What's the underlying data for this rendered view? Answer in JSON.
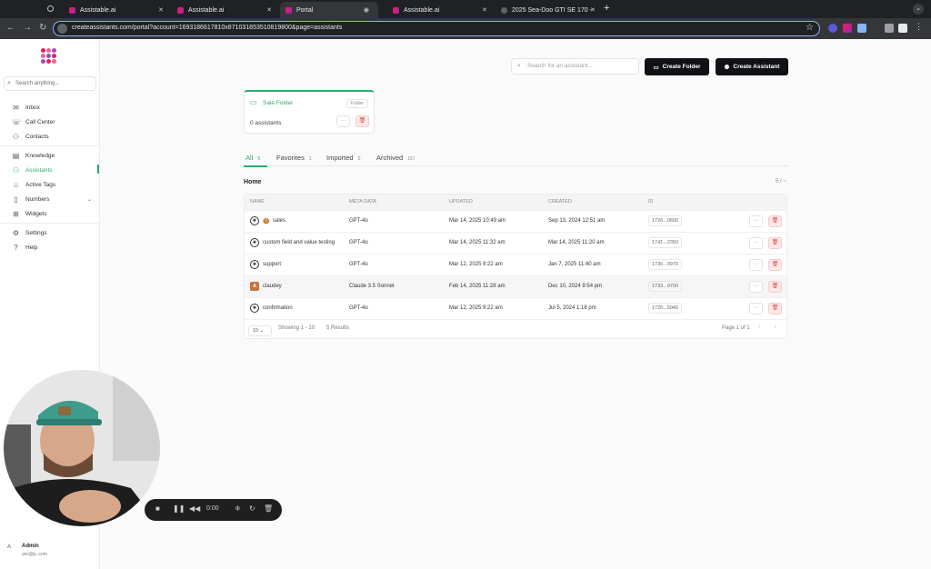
{
  "browser": {
    "tabs": [
      {
        "title": "Assistable.ai"
      },
      {
        "title": "Assistable.ai"
      },
      {
        "title": "Portal"
      },
      {
        "title": "Assistable.ai"
      },
      {
        "title": "2025 Sea-Doo GTI SE 170 - ..."
      }
    ],
    "url": "createassistants.com/portal?account=1693186617810x871031853510819800&page=assistants"
  },
  "sidebar": {
    "search_placeholder": "Search anything...",
    "items": [
      {
        "label": "Inbox",
        "icon": "inbox-icon"
      },
      {
        "label": "Call Center",
        "icon": "phone-icon"
      },
      {
        "label": "Contacts",
        "icon": "contacts-icon"
      },
      {
        "label": "Knowledge",
        "icon": "book-icon"
      },
      {
        "label": "Assistants",
        "icon": "assistant-icon"
      },
      {
        "label": "Active Tags",
        "icon": "tag-icon"
      },
      {
        "label": "Numbers",
        "icon": "phone-device-icon"
      },
      {
        "label": "Widgets",
        "icon": "widgets-icon"
      },
      {
        "label": "Settings",
        "icon": "gear-icon"
      },
      {
        "label": "Help",
        "icon": "help-icon"
      }
    ],
    "user": {
      "avatar": "A",
      "name": "Admin",
      "email": "yes@p..com"
    }
  },
  "header": {
    "search_placeholder": "Search for an assistant...",
    "create_folder": "Create Folder",
    "create_assistant": "Create Assistant"
  },
  "folder": {
    "name": "Sale Folder",
    "tag": "Folder",
    "count": "0 assistants"
  },
  "filter_tabs": [
    {
      "label": "All",
      "count": "5"
    },
    {
      "label": "Favorites",
      "count": "1"
    },
    {
      "label": "Imported",
      "count": "0"
    },
    {
      "label": "Archived",
      "count": "157"
    }
  ],
  "section": {
    "title": "Home",
    "pager": "5 / ~"
  },
  "table": {
    "columns": [
      "NAME",
      "META DATA",
      "UPDATED",
      "CREATED",
      "ID"
    ],
    "rows": [
      {
        "name": "sales",
        "emoji": "🍪",
        "model": "GPT-4o",
        "updated": "Mar 14, 2025 10:49 am",
        "created": "Sep 13, 2024 12:51 am",
        "id": "1726...0600"
      },
      {
        "name": "custom field and value testing",
        "model": "GPT-4o",
        "updated": "Mar 14, 2025 11:32 am",
        "created": "Mar 14, 2025 11:20 am",
        "id": "1741...2350"
      },
      {
        "name": "support",
        "model": "GPT-4o",
        "updated": "Mar 12, 2025 9:22 am",
        "created": "Jan 7, 2025 11:40 am",
        "id": "1736...9970"
      },
      {
        "name": "claudey",
        "model": "Claude 3.5 Sonnet",
        "updated": "Feb 14, 2025 11:28 am",
        "created": "Dec 10, 2024 9:54 pm",
        "id": "1733...9700"
      },
      {
        "name": "confirmation",
        "model": "GPT-4o",
        "updated": "Mar 12, 2025 9:22 am",
        "created": "Jul 5, 2024 1:18 pm",
        "id": "1720...5040"
      }
    ],
    "footer": {
      "per_page": "10",
      "showing": "Showing 1 - 10",
      "results": "5 Results",
      "page": "Page 1 of 1"
    }
  },
  "recorder": {
    "time": "0:00"
  }
}
